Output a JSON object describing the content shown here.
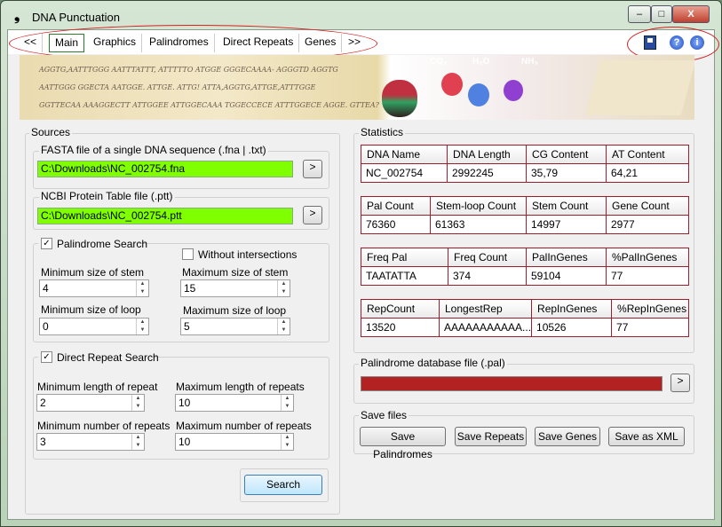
{
  "window": {
    "title": "DNA Punctuation",
    "app_icon": "❟",
    "minimize": "–",
    "maximize": "□",
    "close": "X"
  },
  "toolbar": {
    "tabs": [
      "<<",
      "Main",
      "Graphics",
      "Palindromes",
      "Direct Repeats",
      "Genes",
      ">>"
    ],
    "active": "Main",
    "icons": [
      "save-icon",
      "help-icon",
      "info-icon"
    ]
  },
  "banner": {
    "lines": [
      "AGGTG,AATTTGGG AATTTATTT, ATTTTTO ATGGE GGGECAAAA- AGGGTD AGGTG",
      "AATTGGG GGECTA AATGGE. ATTGE. ATTG! ATTA,AGGTG,ATTGE,ATTTGGE",
      "GGTTECAA AAAGGECTT ATTGGEE ATTGGECAAA TGGECCECE ATTTGGECE AGGE. GTTEA?"
    ],
    "labels": [
      "CO₂",
      "H₂O",
      "NH₃"
    ]
  },
  "sources": {
    "title": "Sources",
    "fasta": {
      "label": "FASTA file of a single DNA sequence (.fna | .txt)",
      "value": "C:\\Downloads\\NC_002754.fna",
      "browse": ">"
    },
    "ptt": {
      "label": "NCBI Protein Table file (.ptt)",
      "value": "C:\\Downloads\\NC_002754.ptt",
      "browse": ">"
    },
    "palindrome": {
      "label": "Palindrome Search",
      "checked": true,
      "without_intersections": "Without intersections",
      "without_checked": false,
      "min_stem_label": "Minimum size of stem",
      "min_stem": "4",
      "max_stem_label": "Maximum size of stem",
      "max_stem": "15",
      "min_loop_label": "Minimum size of loop",
      "min_loop": "0",
      "max_loop_label": "Maximum size of loop",
      "max_loop": "5"
    },
    "repeat": {
      "label": "Direct Repeat Search",
      "checked": true,
      "min_len_label": "Minimum length of repeat",
      "min_len": "2",
      "max_len_label": "Maximum length of repeats",
      "max_len": "10",
      "min_num_label": "Minimum number of repeats",
      "min_num": "3",
      "max_num_label": "Maximum number of repeats",
      "max_num": "10"
    },
    "search": "Search"
  },
  "statistics": {
    "title": "Statistics",
    "tables": [
      {
        "headers": [
          "DNA Name",
          "DNA Length",
          "CG Content",
          "AT Content"
        ],
        "values": [
          "NC_002754",
          "2992245",
          "35,79",
          "64,21"
        ]
      },
      {
        "headers": [
          "Pal Count",
          "Stem-loop Count",
          "Stem Count",
          "Gene Count"
        ],
        "values": [
          "76360",
          "61363",
          "14997",
          "2977"
        ]
      },
      {
        "headers": [
          "Freq Pal",
          "Freq Count",
          "PalInGenes",
          "%PalInGenes"
        ],
        "values": [
          "TAATATTA",
          "374",
          "59104",
          "77"
        ]
      },
      {
        "headers": [
          "RepCount",
          "LongestRep",
          "RepInGenes",
          "%RepInGenes"
        ],
        "values": [
          "13520",
          "AAAAAAAAAAA...",
          "10526",
          "77"
        ]
      }
    ]
  },
  "paldb": {
    "label": "Palindrome database file (.pal)",
    "browse": ">",
    "bar_color": "#b22222"
  },
  "save": {
    "title": "Save files",
    "buttons": [
      "Save Palindromes",
      "Save Repeats",
      "Save Genes",
      "Save as XML"
    ]
  }
}
